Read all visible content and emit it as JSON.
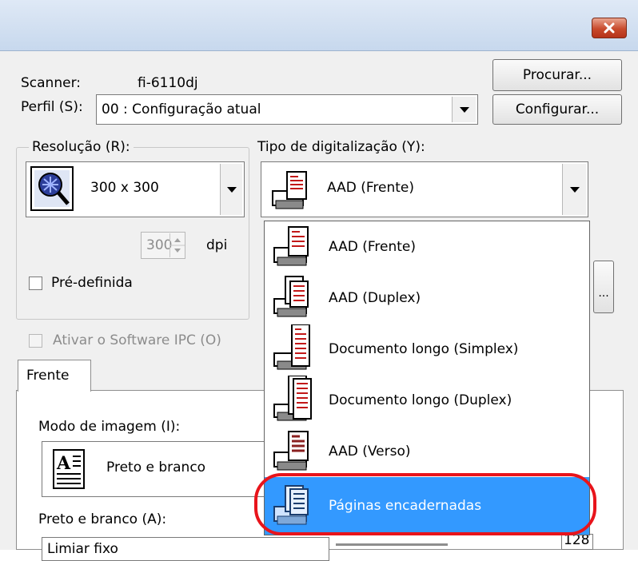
{
  "window": {
    "close_glyph": "×"
  },
  "scanner": {
    "label": "Scanner:",
    "value": "fi-6110dj",
    "browse_button": "Procurar..."
  },
  "profile": {
    "label": "Perfil (S):",
    "value": "00 : Configuração atual",
    "config_button": "Configurar..."
  },
  "resolution": {
    "group_label": "Resolução (R):",
    "value": "300 x 300",
    "custom_value": "300",
    "unit": "dpi",
    "predefined_label": "Pré-definida"
  },
  "scan_type": {
    "label": "Tipo de digitalização (Y):",
    "value": "AAD (Frente)",
    "options": [
      "AAD (Frente)",
      "AAD (Duplex)",
      "Documento longo (Simplex)",
      "Documento longo (Duplex)",
      "AAD (Verso)",
      "Páginas encadernadas"
    ],
    "selected_index": 5
  },
  "ipc": {
    "label": "Ativar o Software IPC (O)"
  },
  "tabs": {
    "front": "Frente"
  },
  "image_mode": {
    "label": "Modo de imagem (I):",
    "value": "Preto e branco"
  },
  "bw": {
    "label": "Preto e branco (A):",
    "value": "Limiar fixo",
    "threshold_value": "128"
  },
  "side_button": "...",
  "colors": {
    "selection": "#3399ff",
    "highlight_ring": "#e8141b",
    "close": "#c84a2c"
  }
}
